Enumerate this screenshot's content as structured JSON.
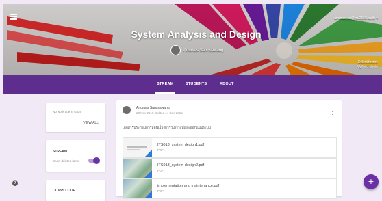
{
  "banner": {
    "class_title": "System Analysis and Design",
    "owner_name": "Anumas Sangsawang",
    "account_email": "anumas.sa@rsu2558.ac.th",
    "account_caret": "▾",
    "select_theme": "Select theme",
    "upload_photo": "Upload photo"
  },
  "tabs": [
    {
      "label": "STREAM",
      "active": true
    },
    {
      "label": "STUDENTS",
      "active": false
    },
    {
      "label": "ABOUT",
      "active": false
    }
  ],
  "upcoming": {
    "text": "No work due in soon",
    "view_all": "VIEW ALL"
  },
  "stream_settings": {
    "heading": "STREAM",
    "toggle_label": "Show deleted items",
    "toggle_on": true
  },
  "class_code": {
    "heading": "CLASS CODE"
  },
  "post": {
    "author": "Anumas Sangsawang",
    "date": "29 Nov 2015 (Edited 14 Dec 2015)",
    "text": "เอกสารประกอบการสอนเรื่องการวิเคราะห์และออกแบบระบบ",
    "attachments": [
      {
        "name": "ITS013_system design1.pdf",
        "type": "PDF",
        "thumb": "document"
      },
      {
        "name": "ITS013_system design2.pdf",
        "type": "PDF",
        "thumb": "image"
      },
      {
        "name": "implementation and maintenance.pdf",
        "type": "PDF",
        "thumb": "image"
      }
    ]
  },
  "icons": {
    "menu": "menu-icon",
    "help": "help-icon",
    "more": "more-vert-icon",
    "fab": "add-icon"
  },
  "colors": {
    "brand_purple": "#5e2e8e",
    "fab_purple": "#6b2fa6",
    "page_bg": "#f1eaf6"
  }
}
